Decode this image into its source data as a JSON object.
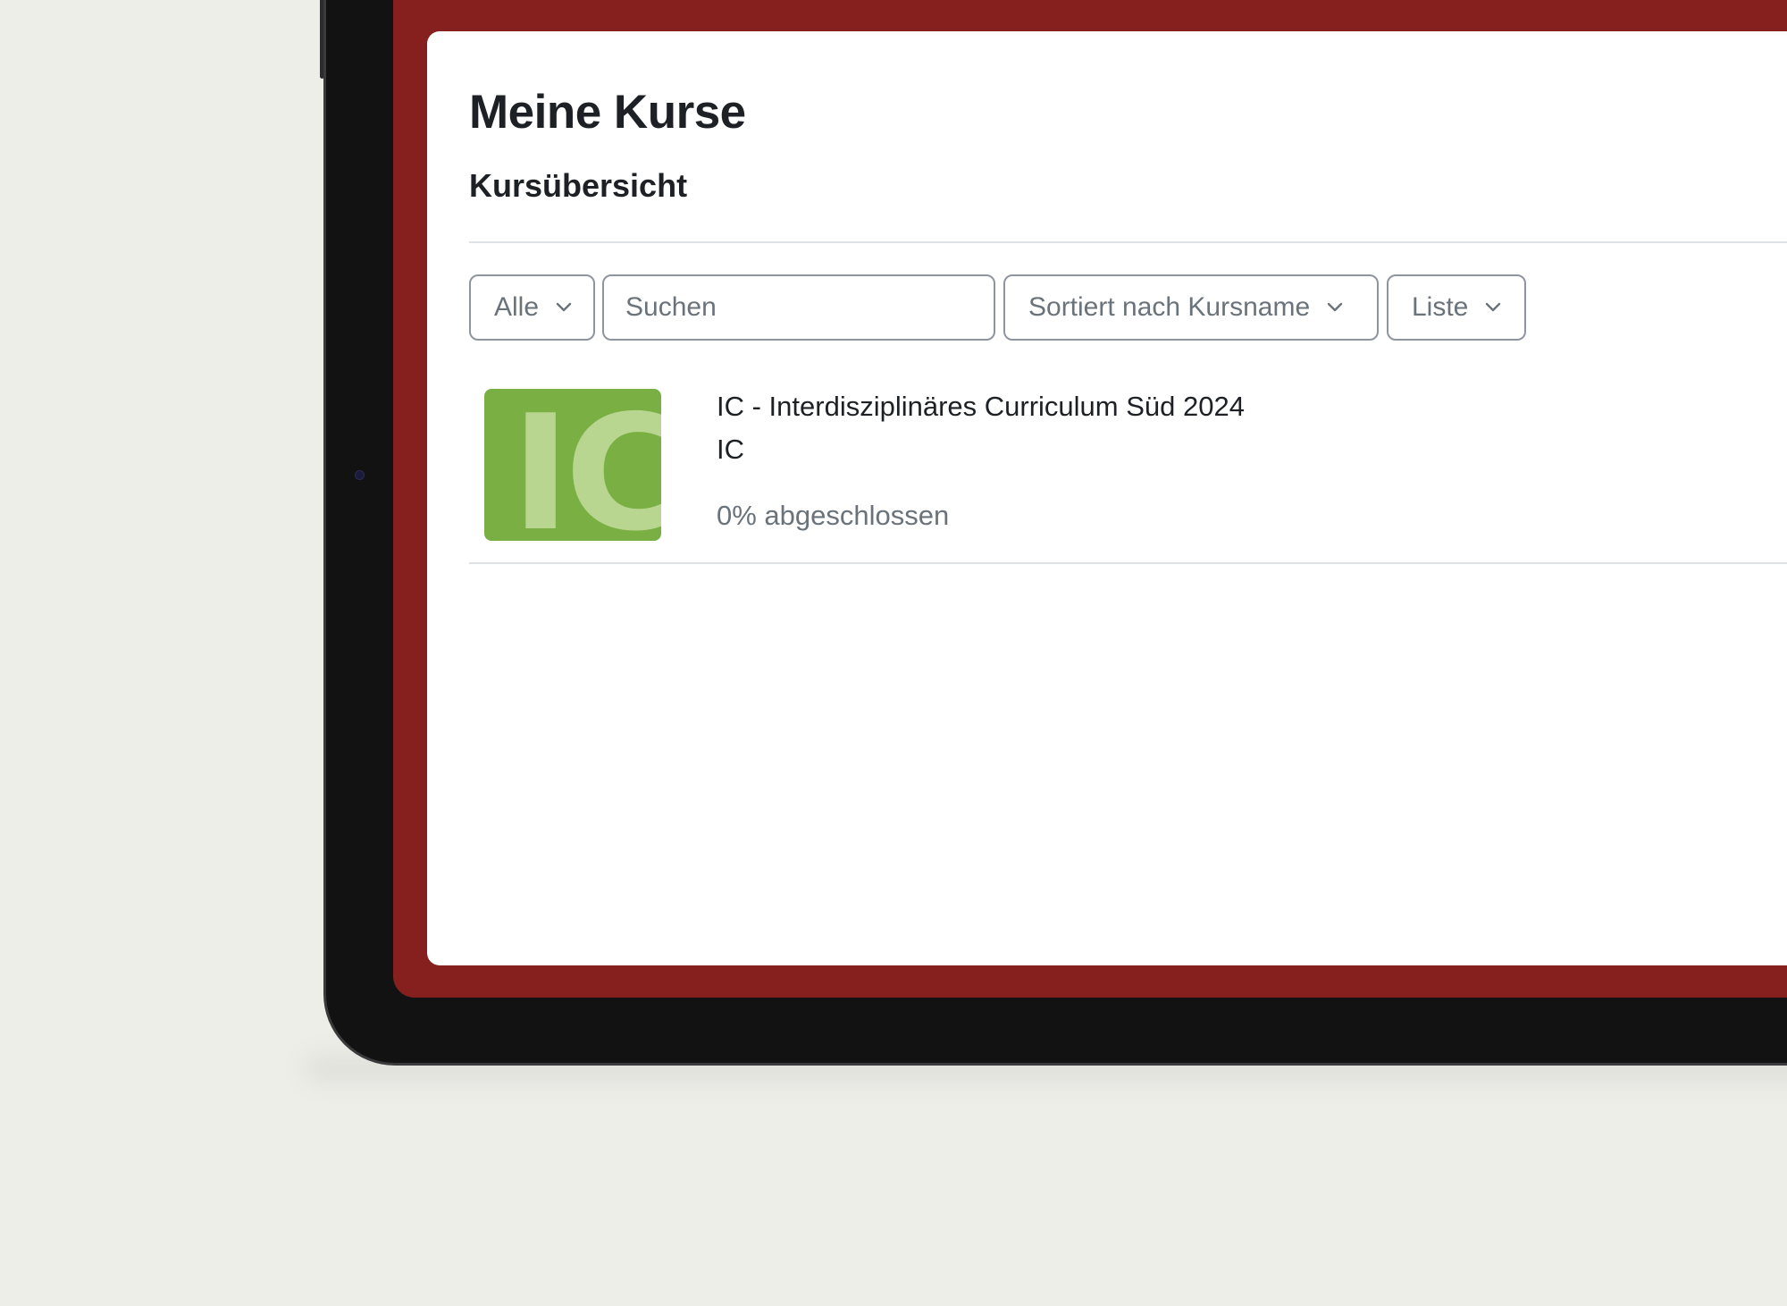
{
  "page": {
    "title": "Meine Kurse",
    "section_title": "Kursübersicht"
  },
  "filters": {
    "grouping_label": "Alle",
    "search_placeholder": "Suchen",
    "search_value": "",
    "sort_label": "Sortiert nach Kursname",
    "view_label": "Liste"
  },
  "courses": [
    {
      "thumbnail_text": "IC",
      "name": "IC - Interdisziplinäres Curriculum Süd 2024",
      "short_name": "IC",
      "progress_text": "0% abgeschlossen",
      "thumbnail_color": "#7ab043"
    }
  ],
  "colors": {
    "frame_accent": "#86201e",
    "text_primary": "#1d2125",
    "text_muted": "#6a737b"
  },
  "icons": {
    "dropdown": "chevron-down-icon"
  }
}
